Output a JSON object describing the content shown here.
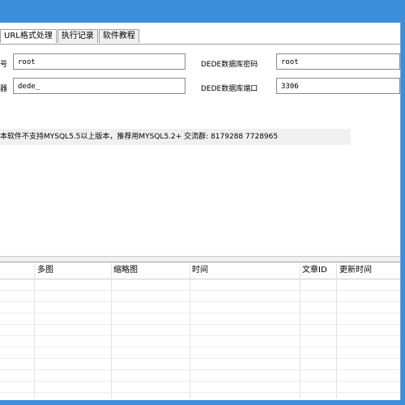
{
  "tabs": [
    "URL格式处理",
    "执行记录",
    "软件教程"
  ],
  "form": {
    "row1_left_label": "号",
    "row1_left_value": "root",
    "row1_right_label": "DEDE数据库密码",
    "row1_right_value": "root",
    "row2_left_label": "器",
    "row2_left_value": "dede_",
    "row2_right_label": "DEDE数据库端口",
    "row2_right_value": "3306"
  },
  "notice": "本软件不支持MYSQL5.5以上版本，推荐用MYSQL5.2+  交流群: 8179288  7728965",
  "table": {
    "columns": [
      "多图",
      "缩略图",
      "时间",
      "文章ID",
      "更新时间"
    ]
  }
}
